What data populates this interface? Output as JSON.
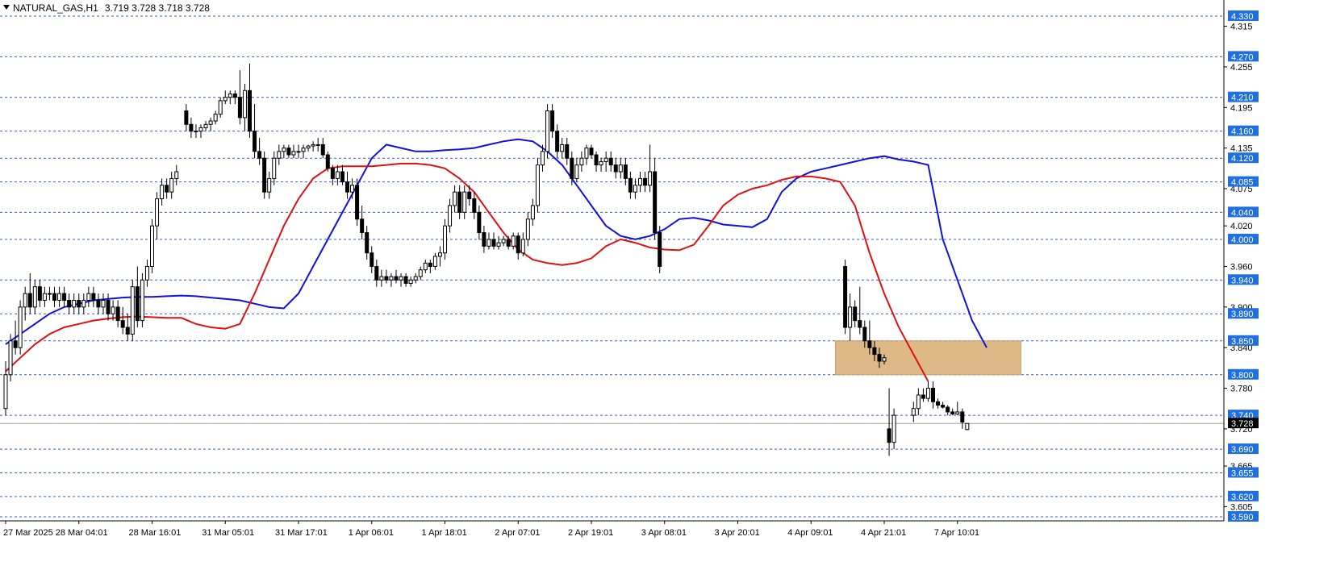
{
  "header": {
    "symbol": "NATURAL_GAS,H1",
    "ohlc": "3.719 3.728 3.718 3.728"
  },
  "colors": {
    "level_line": "#2f5fd0",
    "level_box": "#1f6fe0",
    "ema_fast": "#1010e0",
    "ema_slow": "#e01010",
    "zone": "#deb887",
    "bull_candle": "#ffffff",
    "bear_candle": "#000000",
    "current_price_box": "#000000"
  },
  "chart_data": {
    "type": "candlestick",
    "title": "NATURAL_GAS,H1",
    "ylim": [
      3.59,
      4.345
    ],
    "y_ticks": [
      "4.315",
      "4.255",
      "4.195",
      "4.135",
      "4.075",
      "4.020",
      "3.960",
      "3.900",
      "3.840",
      "3.780",
      "3.720",
      "3.665",
      "3.605"
    ],
    "x_ticks": [
      "27 Mar 2025",
      "28 Mar 04:01",
      "28 Mar 16:01",
      "31 Mar 05:01",
      "31 Mar 17:01",
      "1 Apr 06:01",
      "1 Apr 18:01",
      "2 Apr 07:01",
      "2 Apr 19:01",
      "3 Apr 08:01",
      "3 Apr 20:01",
      "4 Apr 09:01",
      "4 Apr 21:01",
      "7 Apr 10:01"
    ],
    "x_tick_bar_index": [
      0,
      15,
      30,
      45,
      60,
      75,
      90,
      105,
      120,
      135,
      150,
      165,
      180,
      195
    ],
    "levels": [
      "4.330",
      "4.270",
      "4.210",
      "4.160",
      "4.120",
      "4.085",
      "4.040",
      "4.000",
      "3.940",
      "3.890",
      "3.850",
      "3.800",
      "3.740",
      "3.690",
      "3.655",
      "3.620",
      "3.590"
    ],
    "current_price": "3.728",
    "zone": {
      "price_low": 3.8,
      "price_high": 3.85,
      "bar_start": 170,
      "bar_end": 208
    },
    "candles": [
      [
        3.75,
        3.82,
        3.74,
        3.8
      ],
      [
        3.8,
        3.86,
        3.79,
        3.85
      ],
      [
        3.85,
        3.88,
        3.83,
        3.84
      ],
      [
        3.84,
        3.91,
        3.83,
        3.9
      ],
      [
        3.9,
        3.93,
        3.88,
        3.92
      ],
      [
        3.92,
        3.95,
        3.89,
        3.9
      ],
      [
        3.9,
        3.94,
        3.89,
        3.93
      ],
      [
        3.93,
        3.94,
        3.9,
        3.91
      ],
      [
        3.91,
        3.93,
        3.9,
        3.92
      ],
      [
        3.92,
        3.93,
        3.91,
        3.92
      ],
      [
        3.92,
        3.93,
        3.9,
        3.91
      ],
      [
        3.91,
        3.93,
        3.9,
        3.92
      ],
      [
        3.92,
        3.93,
        3.9,
        3.91
      ],
      [
        3.91,
        3.92,
        3.89,
        3.9
      ],
      [
        3.9,
        3.92,
        3.89,
        3.91
      ],
      [
        3.91,
        3.92,
        3.89,
        3.9
      ],
      [
        3.9,
        3.92,
        3.89,
        3.91
      ],
      [
        3.91,
        3.93,
        3.9,
        3.92
      ],
      [
        3.92,
        3.93,
        3.9,
        3.91
      ],
      [
        3.91,
        3.92,
        3.89,
        3.9
      ],
      [
        3.9,
        3.92,
        3.89,
        3.91
      ],
      [
        3.91,
        3.92,
        3.88,
        3.89
      ],
      [
        3.89,
        3.91,
        3.88,
        3.9
      ],
      [
        3.9,
        3.91,
        3.87,
        3.88
      ],
      [
        3.88,
        3.9,
        3.86,
        3.87
      ],
      [
        3.87,
        3.89,
        3.85,
        3.86
      ],
      [
        3.86,
        3.94,
        3.85,
        3.93
      ],
      [
        3.93,
        3.96,
        3.87,
        3.88
      ],
      [
        3.88,
        3.95,
        3.87,
        3.94
      ],
      [
        3.94,
        3.97,
        3.93,
        3.96
      ],
      [
        3.96,
        4.03,
        3.95,
        4.02
      ],
      [
        4.02,
        4.07,
        4.0,
        4.06
      ],
      [
        4.06,
        4.09,
        4.05,
        4.08
      ],
      [
        4.08,
        4.09,
        4.06,
        4.07
      ],
      [
        4.07,
        4.1,
        4.06,
        4.09
      ],
      [
        4.09,
        4.11,
        4.08,
        4.1
      ],
      [
        4.19,
        4.2,
        4.16,
        4.17
      ],
      [
        4.17,
        4.18,
        4.15,
        4.16
      ],
      [
        4.16,
        4.17,
        4.15,
        4.16
      ],
      [
        4.16,
        4.17,
        4.15,
        4.165
      ],
      [
        4.165,
        4.175,
        4.16,
        4.17
      ],
      [
        4.17,
        4.18,
        4.16,
        4.175
      ],
      [
        4.175,
        4.19,
        4.17,
        4.185
      ],
      [
        4.185,
        4.21,
        4.18,
        4.205
      ],
      [
        4.205,
        4.22,
        4.2,
        4.21
      ],
      [
        4.21,
        4.22,
        4.2,
        4.215
      ],
      [
        4.215,
        4.22,
        4.2,
        4.21
      ],
      [
        4.21,
        4.25,
        4.17,
        4.18
      ],
      [
        4.18,
        4.23,
        4.16,
        4.22
      ],
      [
        4.22,
        4.26,
        4.15,
        4.16
      ],
      [
        4.16,
        4.2,
        4.12,
        4.13
      ],
      [
        4.13,
        4.15,
        4.11,
        4.12
      ],
      [
        4.12,
        4.13,
        4.06,
        4.07
      ],
      [
        4.07,
        4.1,
        4.06,
        4.09
      ],
      [
        4.09,
        4.13,
        4.08,
        4.12
      ],
      [
        4.12,
        4.14,
        4.11,
        4.13
      ],
      [
        4.13,
        4.14,
        4.12,
        4.135
      ],
      [
        4.135,
        4.14,
        4.12,
        4.125
      ],
      [
        4.125,
        4.14,
        4.12,
        4.13
      ],
      [
        4.13,
        4.14,
        4.12,
        4.13
      ],
      [
        4.13,
        4.14,
        4.12,
        4.135
      ],
      [
        4.135,
        4.14,
        4.13,
        4.138
      ],
      [
        4.138,
        4.145,
        4.13,
        4.14
      ],
      [
        4.14,
        4.15,
        4.13,
        4.14
      ],
      [
        4.14,
        4.15,
        4.12,
        4.125
      ],
      [
        4.125,
        4.13,
        4.1,
        4.105
      ],
      [
        4.105,
        4.11,
        4.08,
        4.09
      ],
      [
        4.09,
        4.11,
        4.08,
        4.1
      ],
      [
        4.1,
        4.11,
        4.08,
        4.085
      ],
      [
        4.085,
        4.1,
        4.06,
        4.07
      ],
      [
        4.07,
        4.09,
        4.06,
        4.08
      ],
      [
        4.08,
        4.09,
        4.02,
        4.03
      ],
      [
        4.03,
        4.05,
        4.0,
        4.01
      ],
      [
        4.01,
        4.02,
        3.97,
        3.98
      ],
      [
        3.98,
        3.99,
        3.95,
        3.96
      ],
      [
        3.96,
        3.97,
        3.93,
        3.94
      ],
      [
        3.94,
        3.955,
        3.93,
        3.945
      ],
      [
        3.945,
        3.955,
        3.935,
        3.94
      ],
      [
        3.94,
        3.95,
        3.93,
        3.945
      ],
      [
        3.945,
        3.955,
        3.935,
        3.94
      ],
      [
        3.94,
        3.95,
        3.93,
        3.945
      ],
      [
        3.945,
        3.95,
        3.93,
        3.935
      ],
      [
        3.935,
        3.945,
        3.93,
        3.94
      ],
      [
        3.94,
        3.95,
        3.935,
        3.945
      ],
      [
        3.945,
        3.96,
        3.94,
        3.955
      ],
      [
        3.955,
        3.97,
        3.95,
        3.965
      ],
      [
        3.965,
        3.97,
        3.95,
        3.96
      ],
      [
        3.96,
        3.98,
        3.955,
        3.975
      ],
      [
        3.975,
        3.99,
        3.96,
        3.98
      ],
      [
        3.98,
        4.03,
        3.97,
        4.02
      ],
      [
        4.02,
        4.06,
        4.01,
        4.05
      ],
      [
        4.05,
        4.08,
        4.04,
        4.07
      ],
      [
        4.07,
        4.08,
        4.03,
        4.04
      ],
      [
        4.04,
        4.08,
        4.03,
        4.07
      ],
      [
        4.07,
        4.08,
        4.05,
        4.06
      ],
      [
        4.06,
        4.07,
        4.03,
        4.04
      ],
      [
        4.04,
        4.05,
        4.0,
        4.01
      ],
      [
        4.01,
        4.02,
        3.98,
        3.99
      ],
      [
        3.99,
        4.01,
        3.985,
        4.0
      ],
      [
        4.0,
        4.01,
        3.985,
        3.99
      ],
      [
        3.99,
        4.005,
        3.985,
        3.995
      ],
      [
        3.995,
        4.005,
        3.99,
        4.0
      ],
      [
        4.0,
        4.005,
        3.985,
        3.99
      ],
      [
        3.99,
        4.01,
        3.985,
        4.005
      ],
      [
        4.005,
        4.01,
        3.97,
        3.98
      ],
      [
        3.98,
        4.01,
        3.975,
        4.0
      ],
      [
        4.0,
        4.04,
        3.99,
        4.03
      ],
      [
        4.03,
        4.06,
        4.02,
        4.05
      ],
      [
        4.05,
        4.12,
        4.04,
        4.11
      ],
      [
        4.11,
        4.14,
        4.1,
        4.13
      ],
      [
        4.13,
        4.2,
        4.12,
        4.19
      ],
      [
        4.19,
        4.2,
        4.15,
        4.16
      ],
      [
        4.16,
        4.17,
        4.12,
        4.13
      ],
      [
        4.13,
        4.15,
        4.12,
        4.14
      ],
      [
        4.14,
        4.15,
        4.11,
        4.12
      ],
      [
        4.12,
        4.13,
        4.08,
        4.09
      ],
      [
        4.09,
        4.12,
        4.085,
        4.11
      ],
      [
        4.11,
        4.13,
        4.1,
        4.12
      ],
      [
        4.12,
        4.14,
        4.11,
        4.135
      ],
      [
        4.135,
        4.14,
        4.12,
        4.125
      ],
      [
        4.125,
        4.13,
        4.1,
        4.11
      ],
      [
        4.11,
        4.12,
        4.1,
        4.115
      ],
      [
        4.115,
        4.13,
        4.1,
        4.12
      ],
      [
        4.12,
        4.13,
        4.1,
        4.11
      ],
      [
        4.11,
        4.12,
        4.09,
        4.1
      ],
      [
        4.1,
        4.12,
        4.09,
        4.11
      ],
      [
        4.11,
        4.12,
        4.08,
        4.09
      ],
      [
        4.09,
        4.1,
        4.06,
        4.07
      ],
      [
        4.07,
        4.09,
        4.06,
        4.08
      ],
      [
        4.08,
        4.1,
        4.07,
        4.09
      ],
      [
        4.09,
        4.1,
        4.07,
        4.08
      ],
      [
        4.08,
        4.14,
        4.07,
        4.1
      ],
      [
        4.1,
        4.12,
        4.0,
        4.01
      ],
      [
        4.01,
        4.02,
        3.95,
        3.96
      ],
      [
        3.96,
        3.97,
        3.86,
        3.87
      ],
      [
        3.87,
        3.92,
        3.85,
        3.9
      ],
      [
        3.9,
        3.91,
        3.87,
        3.88
      ],
      [
        3.88,
        3.93,
        3.86,
        3.87
      ],
      [
        3.87,
        3.88,
        3.84,
        3.85
      ],
      [
        3.85,
        3.88,
        3.83,
        3.84
      ],
      [
        3.84,
        3.85,
        3.82,
        3.83
      ],
      [
        3.83,
        3.84,
        3.81,
        3.82
      ],
      [
        3.82,
        3.83,
        3.815,
        3.825
      ],
      [
        3.72,
        3.78,
        3.68,
        3.7
      ],
      [
        3.7,
        3.75,
        3.69,
        3.74
      ],
      [
        3.74,
        3.76,
        3.73,
        3.75
      ],
      [
        3.75,
        3.78,
        3.74,
        3.77
      ],
      [
        3.77,
        3.78,
        3.76,
        3.765
      ],
      [
        3.765,
        3.79,
        3.76,
        3.78
      ],
      [
        3.78,
        3.79,
        3.75,
        3.76
      ],
      [
        3.76,
        3.765,
        3.75,
        3.755
      ],
      [
        3.755,
        3.76,
        3.75,
        3.752
      ],
      [
        3.752,
        3.755,
        3.74,
        3.745
      ],
      [
        3.745,
        3.75,
        3.74,
        3.742
      ],
      [
        3.742,
        3.76,
        3.74,
        3.745
      ],
      [
        3.745,
        3.75,
        3.72,
        3.73
      ],
      [
        3.719,
        3.728,
        3.718,
        3.728
      ]
    ],
    "candle_x_index": [
      0,
      1,
      2,
      3,
      4,
      5,
      6,
      7,
      8,
      9,
      10,
      11,
      12,
      13,
      14,
      15,
      16,
      17,
      18,
      19,
      20,
      21,
      22,
      23,
      24,
      25,
      26,
      27,
      28,
      29,
      30,
      31,
      32,
      33,
      34,
      35,
      37,
      38,
      39,
      40,
      41,
      42,
      43,
      44,
      45,
      46,
      47,
      48,
      49,
      50,
      51,
      52,
      53,
      54,
      55,
      56,
      57,
      58,
      59,
      60,
      61,
      62,
      63,
      64,
      65,
      66,
      67,
      68,
      69,
      70,
      71,
      72,
      73,
      74,
      75,
      76,
      77,
      78,
      79,
      80,
      81,
      82,
      83,
      84,
      85,
      86,
      87,
      88,
      89,
      90,
      91,
      92,
      93,
      94,
      95,
      96,
      97,
      98,
      99,
      100,
      101,
      102,
      103,
      104,
      105,
      106,
      107,
      108,
      109,
      110,
      111,
      112,
      113,
      114,
      115,
      116,
      117,
      118,
      119,
      120,
      121,
      122,
      123,
      124,
      125,
      126,
      127,
      128,
      129,
      130,
      131,
      132,
      133,
      134,
      172,
      173,
      174,
      175,
      176,
      177,
      178,
      179,
      180,
      181,
      182,
      186,
      187,
      188,
      189,
      190,
      191,
      192,
      193,
      194,
      195,
      196,
      197,
      198,
      199
    ],
    "series": [
      {
        "name": "",
        "color": "#1010e0",
        "values": [
          3.845,
          3.86,
          3.875,
          3.89,
          3.9,
          3.905,
          3.91,
          3.912,
          3.914,
          3.915,
          3.915,
          3.916,
          3.917,
          3.916,
          3.914,
          3.912,
          3.91,
          3.905,
          3.9,
          3.898,
          3.92,
          3.96,
          4.0,
          4.04,
          4.08,
          4.12,
          4.14,
          4.135,
          4.13,
          4.13,
          4.132,
          4.133,
          4.135,
          4.14,
          4.145,
          4.148,
          4.145,
          4.13,
          4.11,
          4.08,
          4.05,
          4.02,
          4.005,
          4.0,
          4.005,
          4.015,
          4.03,
          4.032,
          4.028,
          4.022,
          4.02,
          4.018,
          4.03,
          4.07,
          4.09,
          4.1,
          4.105,
          4.11,
          4.115,
          4.12,
          4.123,
          4.118,
          4.115,
          4.11,
          4.0,
          3.94,
          3.88,
          3.84
        ]
      },
      {
        "name": "",
        "color": "#e01010",
        "values": [
          3.805,
          3.825,
          3.845,
          3.86,
          3.87,
          3.875,
          3.88,
          3.883,
          3.885,
          3.886,
          3.885,
          3.884,
          3.884,
          3.875,
          3.87,
          3.868,
          3.875,
          3.92,
          3.97,
          4.02,
          4.06,
          4.09,
          4.105,
          4.108,
          4.108,
          4.108,
          4.11,
          4.112,
          4.112,
          4.11,
          4.105,
          4.09,
          4.07,
          4.04,
          4.01,
          3.985,
          3.97,
          3.965,
          3.962,
          3.965,
          3.972,
          3.99,
          4.0,
          3.995,
          3.988,
          3.985,
          3.984,
          3.992,
          4.02,
          4.05,
          4.066,
          4.075,
          4.08,
          4.088,
          4.093,
          4.093,
          4.09,
          4.085,
          4.05,
          3.98,
          3.92,
          3.87,
          3.83,
          3.79
        ]
      }
    ],
    "series_x_index": [
      [
        0,
        3,
        6,
        9,
        12,
        15,
        18,
        21,
        24,
        27,
        30,
        33,
        36,
        39,
        42,
        45,
        48,
        51,
        54,
        57,
        60,
        63,
        66,
        69,
        72,
        75,
        78,
        81,
        84,
        87,
        90,
        93,
        96,
        99,
        102,
        105,
        108,
        111,
        114,
        117,
        120,
        123,
        126,
        129,
        132,
        135,
        138,
        141,
        144,
        147,
        150,
        153,
        156,
        159,
        162,
        165,
        168,
        171,
        174,
        177,
        180,
        183,
        186,
        189,
        192,
        195,
        198,
        201
      ],
      [
        0,
        3,
        6,
        9,
        12,
        15,
        18,
        21,
        24,
        27,
        30,
        33,
        36,
        39,
        42,
        45,
        48,
        51,
        54,
        57,
        60,
        63,
        66,
        69,
        72,
        75,
        78,
        81,
        84,
        87,
        90,
        93,
        96,
        99,
        102,
        105,
        108,
        111,
        114,
        117,
        120,
        123,
        126,
        129,
        132,
        135,
        138,
        141,
        144,
        147,
        150,
        153,
        156,
        159,
        162,
        165,
        168,
        171,
        174,
        177,
        180,
        183,
        186,
        189,
        192,
        195,
        198,
        201
      ]
    ]
  }
}
